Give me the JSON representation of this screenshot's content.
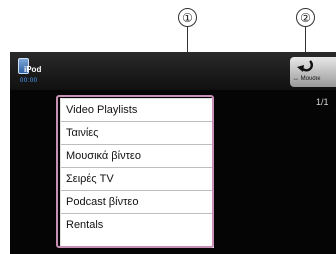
{
  "callouts": [
    "①",
    "②"
  ],
  "device": {
    "label": "iPod",
    "time": "00:00"
  },
  "menu": {
    "items": [
      {
        "label": "Video Playlists"
      },
      {
        "label": "Ταινίες"
      },
      {
        "label": "Μουσικά βίντεο"
      },
      {
        "label": "Σειρές TV"
      },
      {
        "label": "Podcast βίντεο"
      },
      {
        "label": "Rentals"
      }
    ]
  },
  "back_button": {
    "label": "↔ Μουσικ",
    "icon": "back-arrow-icon"
  },
  "page_indicator": "1/1",
  "colors": {
    "highlight": "#c890b4",
    "screen_bg": "#050505",
    "time_text": "#4fa3ff"
  }
}
